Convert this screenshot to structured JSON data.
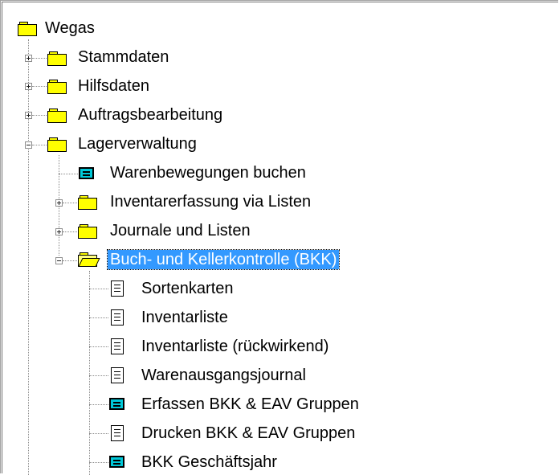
{
  "tree": {
    "root": {
      "label": "Wegas",
      "icon": "folder-icon"
    },
    "items": [
      {
        "label": "Stammdaten",
        "icon": "folder-icon",
        "expander": "plus"
      },
      {
        "label": "Hilfsdaten",
        "icon": "folder-icon",
        "expander": "plus"
      },
      {
        "label": "Auftragsbearbeitung",
        "icon": "folder-icon",
        "expander": "plus"
      },
      {
        "label": "Lagerverwaltung",
        "icon": "folder-icon",
        "expander": "minus"
      },
      {
        "label": "Warenbewegungen buchen",
        "icon": "form-icon"
      },
      {
        "label": "Inventarerfassung via Listen",
        "icon": "folder-icon",
        "expander": "plus"
      },
      {
        "label": "Journale und Listen",
        "icon": "folder-icon",
        "expander": "plus"
      },
      {
        "label": "Buch- und Kellerkontrolle (BKK)",
        "icon": "open-folder-icon",
        "expander": "minus",
        "selected": true
      },
      {
        "label": "Sortenkarten",
        "icon": "report-icon"
      },
      {
        "label": "Inventarliste",
        "icon": "report-icon"
      },
      {
        "label": "Inventarliste (rückwirkend)",
        "icon": "report-icon"
      },
      {
        "label": "Warenausgangsjournal",
        "icon": "report-icon"
      },
      {
        "label": "Erfassen BKK & EAV Gruppen",
        "icon": "form-icon"
      },
      {
        "label": "Drucken BKK & EAV Gruppen",
        "icon": "report-icon"
      },
      {
        "label": "BKK Geschäftsjahr",
        "icon": "form-icon"
      }
    ]
  },
  "colors": {
    "selection": "#3399ff",
    "folder": "#ffff00",
    "form": "#00c8d8"
  }
}
